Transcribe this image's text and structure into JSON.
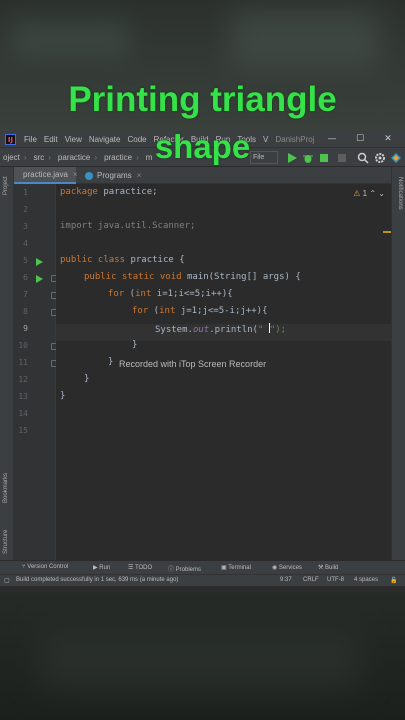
{
  "headline": {
    "line1": "Printing triangle",
    "line2": "shape"
  },
  "menu": {
    "items": [
      "File",
      "Edit",
      "View",
      "Navigate",
      "Code",
      "Refactor",
      "Build",
      "Run",
      "Tools",
      "V"
    ],
    "project": "DanishProj",
    "window_controls": [
      "—",
      "☐",
      "✕"
    ]
  },
  "nav": {
    "crumbs": [
      "oject",
      "src",
      "paractice",
      "practice",
      "m"
    ],
    "config": "File"
  },
  "tabs": [
    {
      "label": "practice.java",
      "active": true
    },
    {
      "label": "Programs",
      "active": false
    }
  ],
  "side": {
    "project": "Project",
    "bookmarks": "Bookmarks",
    "structure": "Structure",
    "notifications": "Notifications"
  },
  "warnings": {
    "count": "1"
  },
  "editor": {
    "line_numbers": [
      "1",
      "2",
      "3",
      "4",
      "5",
      "6",
      "7",
      "8",
      "9",
      "10",
      "11",
      "12",
      "13",
      "14",
      "15"
    ],
    "current_line": 9,
    "l1": {
      "kw": "package",
      "rest": " paractice;"
    },
    "l3": "import java.util.Scanner;",
    "l5": {
      "kw": "public class",
      "rest": " practice {"
    },
    "l6": {
      "kw": "public static void",
      "rest": " main(String[] args) {"
    },
    "l7": {
      "kw": "for",
      "a": " (",
      "kw2": "int",
      "b": " i=1;i<=5;i++){"
    },
    "l8": {
      "kw": "for",
      "a": " (",
      "kw2": "int",
      "b": " j=1;j<=5-i;j++){"
    },
    "l9": {
      "a": "System.",
      "fld": "out",
      "b": ".println(",
      "str": "\" ",
      "c": "\");"
    },
    "l10": "}",
    "l11": "}",
    "l12": "}",
    "l13": "}",
    "recorder": "Recorded with iTop Screen Recorder"
  },
  "toolwindows": [
    "Version Control",
    "Run",
    "TODO",
    "Problems",
    "Terminal",
    "Services",
    "Build"
  ],
  "status": {
    "message": "Build completed successfully in 1 sec, 639 ms (a minute ago)",
    "position": "9:37",
    "line_sep": "CRLF",
    "encoding": "UTF-8",
    "indent": "4 spaces"
  },
  "colors": {
    "headline": "#35e24a",
    "keyword": "#cc7832",
    "text": "#a9b7c6",
    "string": "#6a8759",
    "field": "#9876aa"
  }
}
